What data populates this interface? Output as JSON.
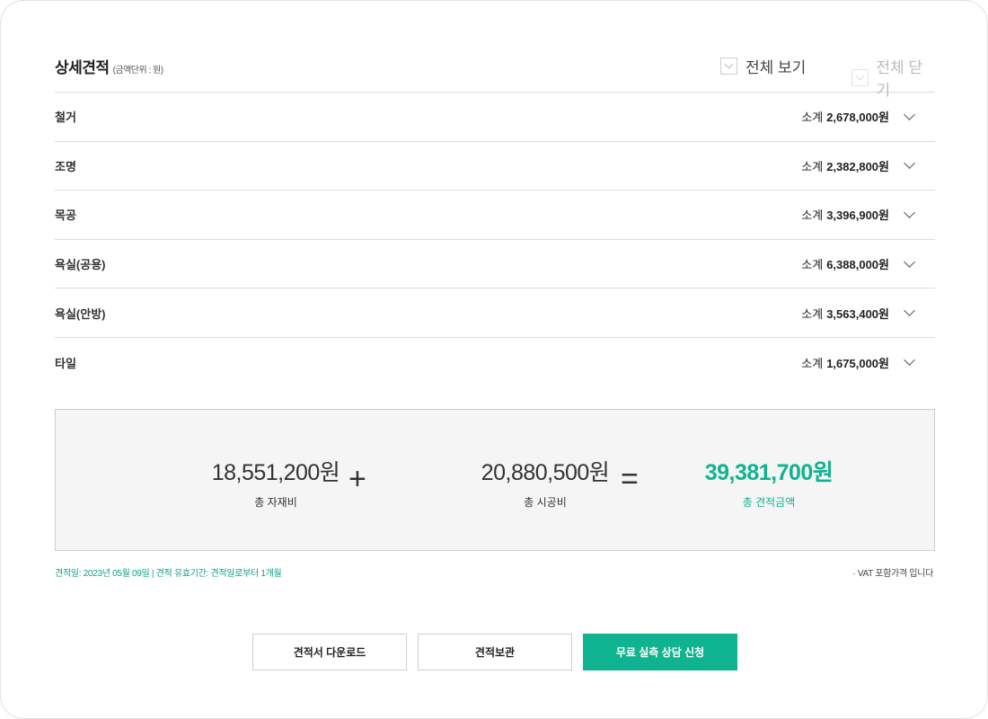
{
  "header": {
    "title": "상세견적",
    "unit": "(금액단위 : 원)",
    "expand_all": "전체 보기",
    "collapse_all": "전체 닫기"
  },
  "rows": [
    {
      "name": "철거",
      "subtotal_label": "소계",
      "subtotal": "2,678,000원"
    },
    {
      "name": "조명",
      "subtotal_label": "소계",
      "subtotal": "2,382,800원"
    },
    {
      "name": "목공",
      "subtotal_label": "소계",
      "subtotal": "3,396,900원"
    },
    {
      "name": "욕실(공용)",
      "subtotal_label": "소계",
      "subtotal": "6,388,000원"
    },
    {
      "name": "욕실(안방)",
      "subtotal_label": "소계",
      "subtotal": "3,563,400원"
    },
    {
      "name": "타일",
      "subtotal_label": "소계",
      "subtotal": "1,675,000원"
    }
  ],
  "summary": {
    "materials_value": "18,551,200원",
    "materials_label": "총 자재비",
    "plus": "+",
    "labor_value": "20,880,500원",
    "labor_label": "총 시공비",
    "equals": "=",
    "total_value": "39,381,700원",
    "total_label": "총 견적금액"
  },
  "footer": {
    "date_info": "견적일: 2023년 05월 09일 | 견적 유효기간: 견적일로부터 1개월",
    "vat_note": "· VAT 포함가격 입니다"
  },
  "buttons": {
    "download": "견적서 다운로드",
    "save": "견적보관",
    "consult": "무료 실측 상담 신청"
  },
  "colors": {
    "accent": "#10b38f"
  }
}
